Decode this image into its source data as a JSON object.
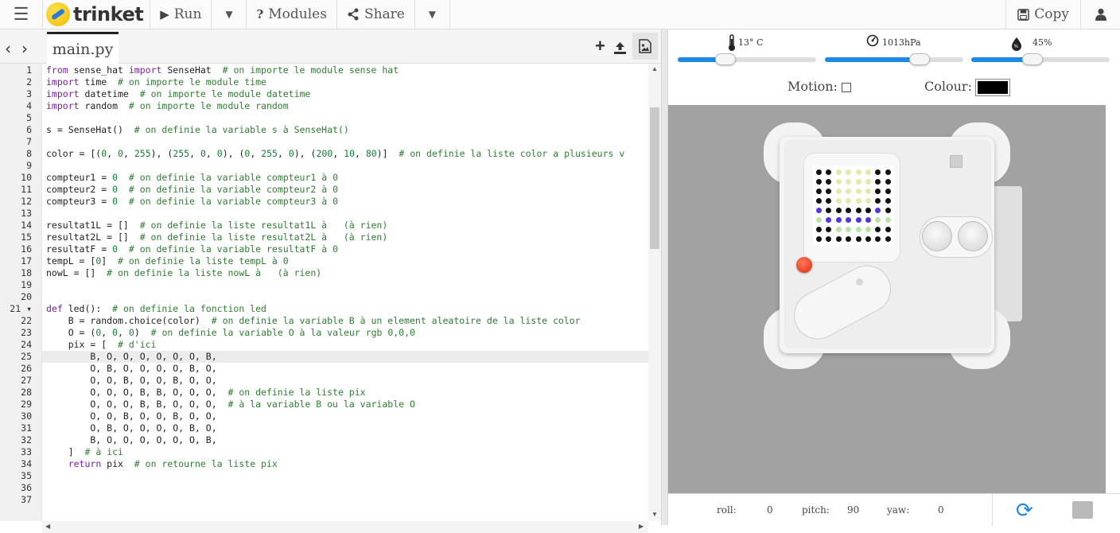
{
  "toolbar": {
    "logo_text": "trinket",
    "run_label": "Run",
    "modules_label": "Modules",
    "share_label": "Share",
    "copy_label": "Copy"
  },
  "editor": {
    "tab_label": "main.py",
    "active_line": 25,
    "lines": [
      "from sense_hat import SenseHat  # on importe le module sense hat",
      "import time  # on importe le module time",
      "import datetime  # on importe le module datetime",
      "import random  # on importe le module random",
      "",
      "s = SenseHat()  # on definie la variable s à SenseHat()",
      "",
      "color = [(0, 0, 255), (255, 0, 0), (0, 255, 0), (200, 10, 80)]  # on definie la liste color a plusieurs v",
      "",
      "compteur1 = 0  # on definie la variable compteur1 à 0",
      "compteur2 = 0  # on definie la variable compteur2 à 0",
      "compteur3 = 0  # on definie la variable compteur3 à 0",
      "",
      "resultat1L = []  # on definie la liste resultat1L à   (à rien)",
      "resultat2L = []  # on definie la liste resultat2L à   (à rien)",
      "resultatF = 0  # on definie la variable resultatF à 0",
      "tempL = [0]  # on definie la liste tempL à 0",
      "nowL = []  # on definie la liste nowL à   (à rien)",
      "",
      "",
      "def led():  # on definie la fonction led",
      "    B = random.choice(color)  # on definie la variable B à un element aleatoire de la liste color",
      "    O = (0, 0, 0)  # on definie la variable O à la valeur rgb 0,0,0",
      "    pix = [  # d'ici",
      "        B, O, O, O, O, O, O, B,",
      "        O, B, O, O, O, O, B, O,",
      "        O, O, B, O, O, B, O, O,",
      "        O, O, O, B, B, O, O, O,  # on definie la liste pix",
      "        O, O, O, B, B, O, O, O,  # à la variable B ou la variable O",
      "        O, O, B, O, O, B, O, O,",
      "        O, B, O, O, O, O, B, O,",
      "        B, O, O, O, O, O, O, B,",
      "    ]  # à ici",
      "    return pix  # on retourne la liste pix",
      "",
      "",
      ""
    ]
  },
  "sensors": {
    "temperature": {
      "label": "13° C",
      "value": 13
    },
    "pressure": {
      "label": "1013hPa",
      "value": 1013
    },
    "humidity": {
      "label": "45%",
      "value": 45
    }
  },
  "controls": {
    "motion_label": "Motion:",
    "colour_label": "Colour:",
    "colour_value": "#000000"
  },
  "led_matrix": {
    "colors": {
      "K": "#111111",
      "Y": "#e5e8a8",
      "G": "#b7e3a3",
      "P": "#5533dd"
    },
    "rows": [
      "KKYYYYKK",
      "KKYYYYKK",
      "KKYYYYKK",
      "KKYYYYKK",
      "PKKKKKPK",
      "GPPPPPGG",
      "KKGGGGKK",
      "KKKKKKKK"
    ]
  },
  "status": {
    "roll_label": "roll:",
    "roll_value": "0",
    "pitch_label": "pitch:",
    "pitch_value": "90",
    "yaw_label": "yaw:",
    "yaw_value": "0"
  }
}
